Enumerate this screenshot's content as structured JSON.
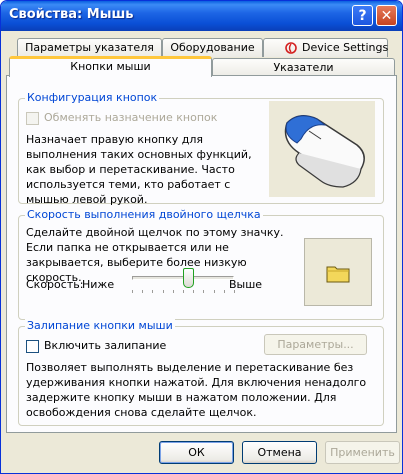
{
  "window": {
    "title": "Свойства: Мышь",
    "help_label": "?",
    "close_label": "✕"
  },
  "tabs": {
    "top_row": [
      "Параметры указателя",
      "Оборудование",
      "Device Settings"
    ],
    "bottom_row": [
      "Кнопки мыши",
      "Указатели"
    ],
    "active": "Кнопки мыши"
  },
  "button_config": {
    "title": "Конфигурация кнопок",
    "swap_label": "Обменять назначение кнопок",
    "swap_checked": false,
    "swap_enabled": false,
    "description": "Назначает правую кнопку для выполнения таких основных функций, как выбор и перетаскивание. Часто используется теми, кто работает с мышью левой рукой."
  },
  "double_click": {
    "title": "Скорость выполнения двойного щелчка",
    "description": "Сделайте двойной щелчок по этому значку. Если папка не открывается или не закрывается, выберите более низкую скорость.",
    "speed_label": "Скорость:",
    "low_label": "Ниже",
    "high_label": "Выше",
    "speed_fraction": 0.55
  },
  "click_lock": {
    "title": "Залипание кнопки мыши",
    "enable_label": "Включить залипание",
    "enable_checked": false,
    "settings_label": "Параметры...",
    "description": "Позволяет выполнять выделение и перетаскивание без удерживания кнопки нажатой. Для включения ненадолго задержите кнопку мыши в нажатом положении. Для освобождения снова сделайте щелчок."
  },
  "footer": {
    "ok_label": "ОК",
    "cancel_label": "Отмена",
    "apply_label": "Применить"
  },
  "colors": {
    "title_bar": "#0A4FD6",
    "group_title": "#0046D5",
    "active_tab_accent": "#FFC73C",
    "dialog_bg": "#ECE9D8"
  }
}
